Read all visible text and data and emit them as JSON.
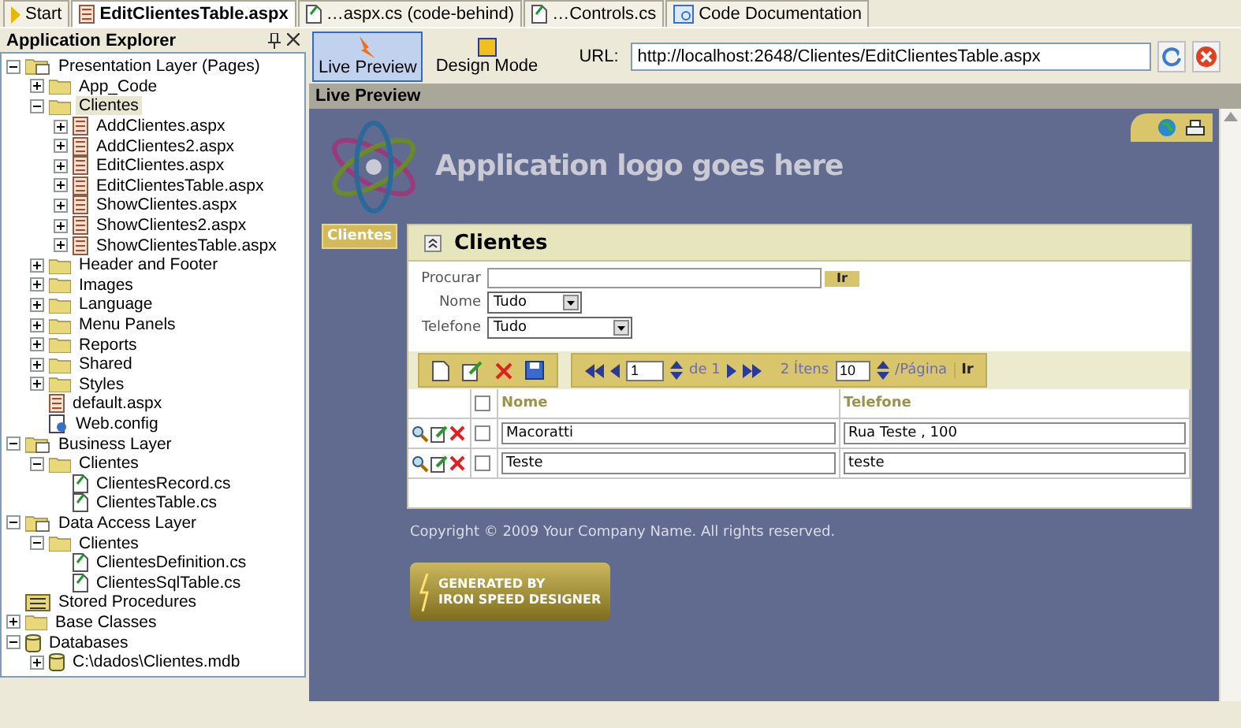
{
  "document_tabs": [
    {
      "label": "Start",
      "kind": "start",
      "selected": false
    },
    {
      "label": "EditClientesTable.aspx",
      "kind": "aspx",
      "selected": true
    },
    {
      "label": "…aspx.cs (code-behind)",
      "kind": "cs",
      "selected": false
    },
    {
      "label": "…Controls.cs",
      "kind": "cs",
      "selected": false
    },
    {
      "label": "Code Documentation",
      "kind": "doc",
      "selected": false
    }
  ],
  "explorer": {
    "title": "Application Explorer",
    "tree": [
      {
        "label": "Presentation Layer (Pages)",
        "kind": "layer",
        "expanded": true,
        "children": [
          {
            "label": "App_Code",
            "kind": "folder",
            "expanded": false
          },
          {
            "label": "Clientes",
            "kind": "folder",
            "expanded": true,
            "selected": true,
            "children": [
              {
                "label": "AddClientes.aspx",
                "kind": "aspx",
                "expanded": false
              },
              {
                "label": "AddClientes2.aspx",
                "kind": "aspx",
                "expanded": false
              },
              {
                "label": "EditClientes.aspx",
                "kind": "aspx",
                "expanded": false
              },
              {
                "label": "EditClientesTable.aspx",
                "kind": "aspx",
                "expanded": false
              },
              {
                "label": "ShowClientes.aspx",
                "kind": "aspx",
                "expanded": false
              },
              {
                "label": "ShowClientes2.aspx",
                "kind": "aspx",
                "expanded": false
              },
              {
                "label": "ShowClientesTable.aspx",
                "kind": "aspx",
                "expanded": false
              }
            ]
          },
          {
            "label": "Header and Footer",
            "kind": "folder",
            "expanded": false
          },
          {
            "label": "Images",
            "kind": "folder",
            "expanded": false
          },
          {
            "label": "Language",
            "kind": "folder",
            "expanded": false
          },
          {
            "label": "Menu Panels",
            "kind": "folder",
            "expanded": false
          },
          {
            "label": "Reports",
            "kind": "folder",
            "expanded": false
          },
          {
            "label": "Shared",
            "kind": "folder",
            "expanded": false
          },
          {
            "label": "Styles",
            "kind": "folder",
            "expanded": false
          },
          {
            "label": "default.aspx",
            "kind": "aspx"
          },
          {
            "label": "Web.config",
            "kind": "config"
          }
        ]
      },
      {
        "label": "Business Layer",
        "kind": "layer",
        "expanded": true,
        "children": [
          {
            "label": "Clientes",
            "kind": "folder",
            "expanded": true,
            "children": [
              {
                "label": "ClientesRecord.cs",
                "kind": "cs"
              },
              {
                "label": "ClientesTable.cs",
                "kind": "cs"
              }
            ]
          }
        ]
      },
      {
        "label": "Data Access Layer",
        "kind": "layer",
        "expanded": true,
        "children": [
          {
            "label": "Clientes",
            "kind": "folder",
            "expanded": true,
            "children": [
              {
                "label": "ClientesDefinition.cs",
                "kind": "cs"
              },
              {
                "label": "ClientesSqlTable.cs",
                "kind": "cs"
              }
            ]
          }
        ]
      },
      {
        "label": "Stored Procedures",
        "kind": "sql"
      },
      {
        "label": "Base Classes",
        "kind": "folder",
        "expanded": false
      },
      {
        "label": "Databases",
        "kind": "database",
        "expanded": true,
        "children": [
          {
            "label": "C:\\dados\\Clientes.mdb",
            "kind": "database",
            "expanded": false
          }
        ]
      }
    ]
  },
  "preview_toolbar": {
    "modes": [
      {
        "label": "Live Preview",
        "kind": "live",
        "selected": true
      },
      {
        "label": "Design Mode",
        "kind": "design",
        "selected": false
      }
    ],
    "url_label": "URL:",
    "url": "http://localhost:2648/Clientes/EditClientesTable.aspx"
  },
  "preview_title": "Live Preview",
  "site": {
    "logo_text": "Application logo goes here",
    "menu": [
      {
        "label": "Clientes"
      }
    ],
    "panel": {
      "title": "Clientes",
      "filters": [
        {
          "label": "Procurar",
          "kind": "search",
          "button": "Ir"
        },
        {
          "label": "Nome",
          "kind": "select",
          "value": "Tudo"
        },
        {
          "label": "Telefone",
          "kind": "select",
          "value": "Tudo"
        }
      ],
      "pager": {
        "page": "1",
        "of": "de 1",
        "items": "2 Ítens",
        "page_size": "10",
        "per_page": "/Página",
        "go": "Ir"
      },
      "table": {
        "header_checked": false,
        "columns": [
          "Nome",
          "Telefone"
        ],
        "rows": [
          {
            "checked": false,
            "cells": [
              "Macoratti",
              "Rua Teste , 100"
            ]
          },
          {
            "checked": false,
            "cells": [
              "Teste",
              "teste"
            ]
          }
        ]
      }
    },
    "copyright": "Copyright © 2009 Your Company Name. All rights reserved.",
    "badge": [
      "GENERATED BY",
      "IRON SPEED DESIGNER"
    ]
  }
}
